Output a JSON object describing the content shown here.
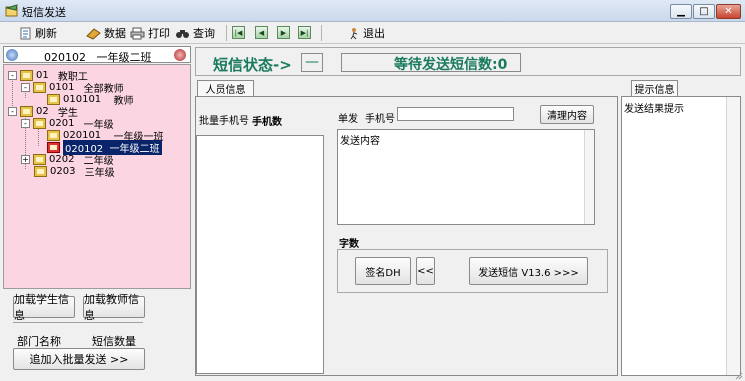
{
  "window": {
    "title": "短信发送"
  },
  "toolbar": {
    "refresh": "刷新",
    "data": "数据",
    "print": "打印",
    "query": "查询",
    "exit": "退出",
    "nav_first": "|◀",
    "nav_prev": "◀",
    "nav_next": "▶",
    "nav_last": "▶|"
  },
  "class_bar": {
    "code": "020102",
    "name": "一年级二班"
  },
  "tree": [
    {
      "expander": "-",
      "code": "01",
      "name": "教职工"
    },
    {
      "expander": "-",
      "code": "0101",
      "name": "全部教师"
    },
    {
      "expander": "",
      "code": "010101",
      "name": "教师"
    },
    {
      "expander": "-",
      "code": "02",
      "name": "学生"
    },
    {
      "expander": "-",
      "code": "0201",
      "name": "一年级"
    },
    {
      "expander": "",
      "code": "020101",
      "name": "一年级一班"
    },
    {
      "expander": "",
      "code": "020102",
      "name": "一年级二班"
    },
    {
      "expander": "+",
      "code": "0202",
      "name": "二年级"
    },
    {
      "expander": "",
      "code": "0203",
      "name": "三年级"
    }
  ],
  "left_panel": {
    "load_students": "加载学生信息",
    "load_teachers": "加载教师信息",
    "dept_name_label": "部门名称",
    "sms_count_label": "短信数量",
    "add_batch_button": "追加入批量发送 >>"
  },
  "status": {
    "label": "短信状态->",
    "value": "—",
    "pending": "等待发送短信数:0"
  },
  "tabs": {
    "people": "人员信息",
    "hint": "提示信息"
  },
  "people": {
    "batch_phone_label": "批量手机号",
    "phone_count_label": "手机数",
    "single_label": "单发",
    "phone_label": "手机号",
    "phone_value": "",
    "clear_button": "清理内容",
    "content_text": "发送内容",
    "word_count_label": "字数",
    "sign_button": "签名DH",
    "prev_button": "<<",
    "send_button": "发送短信 V13.6 >>>"
  },
  "hint": {
    "text": "发送结果提示"
  },
  "colors": {
    "status_text": "#1a7a5e",
    "tree_background": "#fbd6e2",
    "selection": "#0a246a"
  }
}
